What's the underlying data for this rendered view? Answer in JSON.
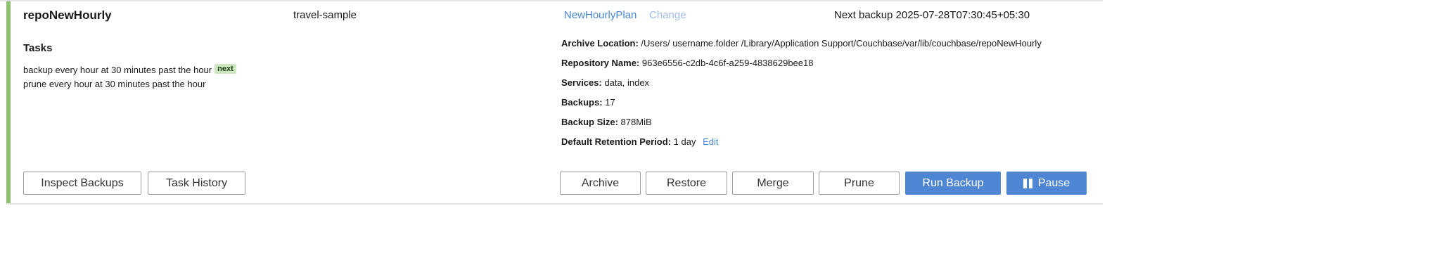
{
  "repo": {
    "name": "repoNewHourly",
    "bucket": "travel-sample",
    "plan": "NewHourlyPlan",
    "change_label": "Change",
    "next_backup": "Next backup 2025-07-28T07:30:45+05:30"
  },
  "tasks": {
    "title": "Tasks",
    "items": [
      {
        "text": "backup every hour at 30 minutes past the hour",
        "badge": "next"
      },
      {
        "text": "prune every hour at 30 minutes past the hour",
        "badge": ""
      }
    ]
  },
  "details": {
    "archive_location": {
      "label": "Archive Location:",
      "value": "/Users/ username.folder /Library/Application Support/Couchbase/var/lib/couchbase/repoNewHourly"
    },
    "repository_name": {
      "label": "Repository Name:",
      "value": "963e6556-c2db-4c6f-a259-4838629bee18"
    },
    "services": {
      "label": "Services:",
      "value": "data, index"
    },
    "backups": {
      "label": "Backups:",
      "value": "17"
    },
    "backup_size": {
      "label": "Backup Size:",
      "value": "878MiB"
    },
    "retention": {
      "label": "Default Retention Period:",
      "value": "1 day",
      "edit_label": "Edit"
    }
  },
  "buttons": {
    "inspect_backups": "Inspect Backups",
    "task_history": "Task History",
    "archive": "Archive",
    "restore": "Restore",
    "merge": "Merge",
    "prune": "Prune",
    "run_backup": "Run Backup",
    "pause": "Pause"
  },
  "colors": {
    "accent": "#8cc06a",
    "link": "#4a86d6",
    "primary_button": "#4f86d4",
    "badge_bg": "#cde6c0"
  },
  "icons": {
    "pause": "pause-icon"
  }
}
